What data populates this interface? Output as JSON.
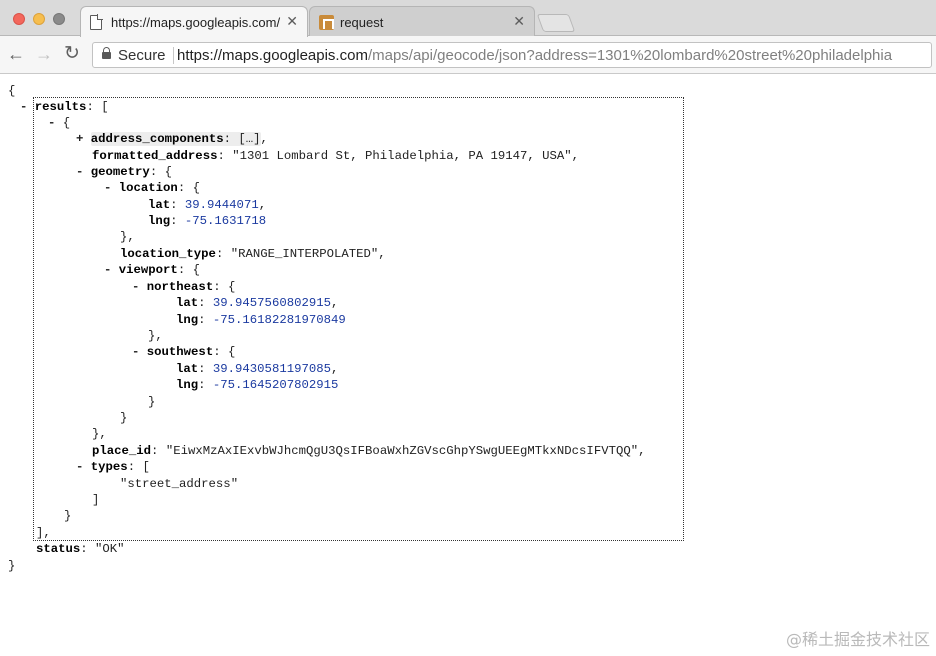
{
  "window": {
    "tabs": [
      {
        "title": "https://maps.googleapis.com/m",
        "close": "✕"
      },
      {
        "title": "request",
        "close": "✕"
      }
    ]
  },
  "toolbar": {
    "back_icon": "arrow-left-icon",
    "forward_icon": "arrow-right-icon",
    "reload_icon": "reload-icon",
    "secure_label": "Secure",
    "url_host": "https://maps.googleapis.com",
    "url_path": "/maps/api/geocode/json?address=1301%20lombard%20street%20philadelphia"
  },
  "json_view": {
    "open_brace": "{",
    "close_brace": "}",
    "results_key": "results",
    "address_components_key": "address_components",
    "address_components_collapsed": "[…]",
    "formatted_address_key": "formatted_address",
    "formatted_address_value": "\"1301 Lombard St, Philadelphia, PA 19147, USA\"",
    "geometry_key": "geometry",
    "location_key": "location",
    "location_lat_key": "lat",
    "location_lat_value": "39.9444071",
    "location_lng_key": "lng",
    "location_lng_value": "-75.1631718",
    "location_type_key": "location_type",
    "location_type_value": "\"RANGE_INTERPOLATED\"",
    "viewport_key": "viewport",
    "northeast_key": "northeast",
    "northeast_lat_key": "lat",
    "northeast_lat_value": "39.9457560802915",
    "northeast_lng_key": "lng",
    "northeast_lng_value": "-75.16182281970849",
    "southwest_key": "southwest",
    "southwest_lat_key": "lat",
    "southwest_lat_value": "39.9430581197085",
    "southwest_lng_key": "lng",
    "southwest_lng_value": "-75.1645207802915",
    "place_id_key": "place_id",
    "place_id_value": "\"EiwxMzAxIExvbWJhcmQgU3QsIFBoaWxhZGVscGhpYSwgUEEgMTkxNDcsIFVTQQ\"",
    "types_key": "types",
    "types_item": "\"street_address\"",
    "status_key": "status",
    "status_value": "\"OK\"",
    "toggle_expanded": "-",
    "toggle_collapsed": "+"
  },
  "watermark": "@稀土掘金技术社区"
}
